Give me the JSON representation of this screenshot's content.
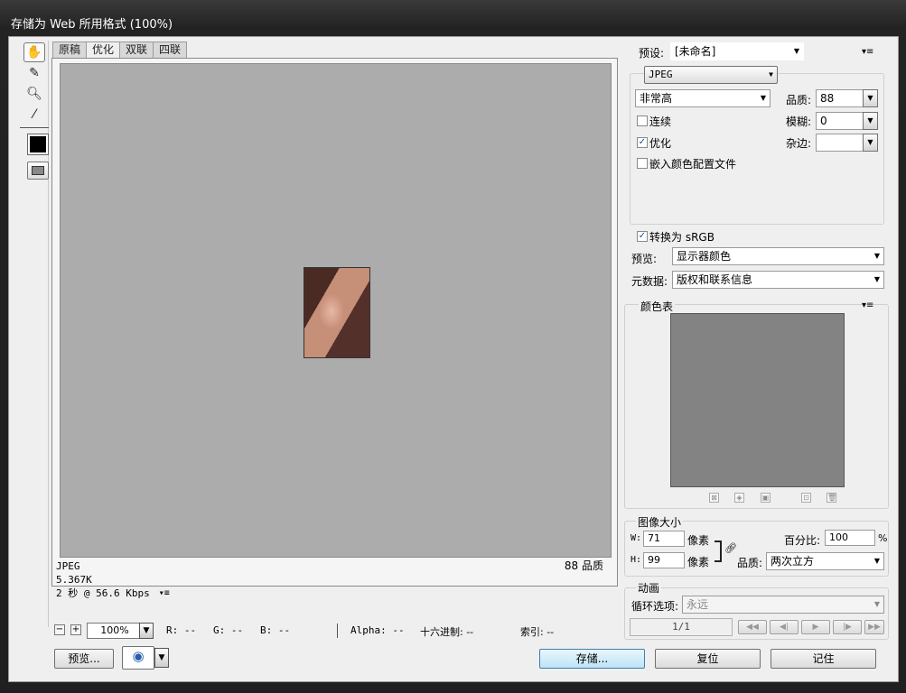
{
  "window": {
    "title": "存储为 Web 所用格式 (100%)"
  },
  "tabs": [
    "原稿",
    "优化",
    "双联",
    "四联"
  ],
  "active_tab": "优化",
  "info": {
    "format": "JPEG",
    "size": "5.367K",
    "time": "2 秒 @ 56.6 Kbps",
    "quality": "88 品质"
  },
  "status": {
    "zoom": "100%",
    "r": "R: --",
    "g": "G: --",
    "b": "B: --",
    "alpha": "Alpha: --",
    "hex": "十六进制: --",
    "index": "索引: --"
  },
  "bottom": {
    "preview_btn": "预览...",
    "save_btn": "存储...",
    "reset_btn": "复位",
    "remember_btn": "记住"
  },
  "settings": {
    "preset_label": "预设:",
    "preset_value": "[未命名]",
    "format_value": "JPEG",
    "quality_preset": "非常高",
    "quality_label": "品质:",
    "quality_value": "88",
    "progressive_label": "连续",
    "progressive_checked": false,
    "blur_label": "模糊:",
    "blur_value": "0",
    "optimized_label": "优化",
    "optimized_checked": true,
    "matte_label": "杂边:",
    "matte_value": "",
    "embed_label": "嵌入颜色配置文件",
    "embed_checked": false,
    "srgb_label": "转换为 sRGB",
    "srgb_checked": true,
    "preview_label": "预览:",
    "preview_value": "显示器颜色",
    "metadata_label": "元数据:",
    "metadata_value": "版权和联系信息"
  },
  "color_table": {
    "title": "颜色表"
  },
  "image_size": {
    "title": "图像大小",
    "w_label": "W:",
    "w_value": "71",
    "h_label": "H:",
    "h_value": "99",
    "unit": "像素",
    "percent_label": "百分比:",
    "percent_value": "100",
    "percent_unit": "%",
    "quality_label": "品质:",
    "quality_value": "两次立方"
  },
  "animation": {
    "title": "动画",
    "loop_label": "循环选项:",
    "loop_value": "永远",
    "frame": "1/1"
  },
  "colors": {
    "accent": "#3c7fb1",
    "canvas": "#acacac",
    "swatch": "#000000"
  }
}
